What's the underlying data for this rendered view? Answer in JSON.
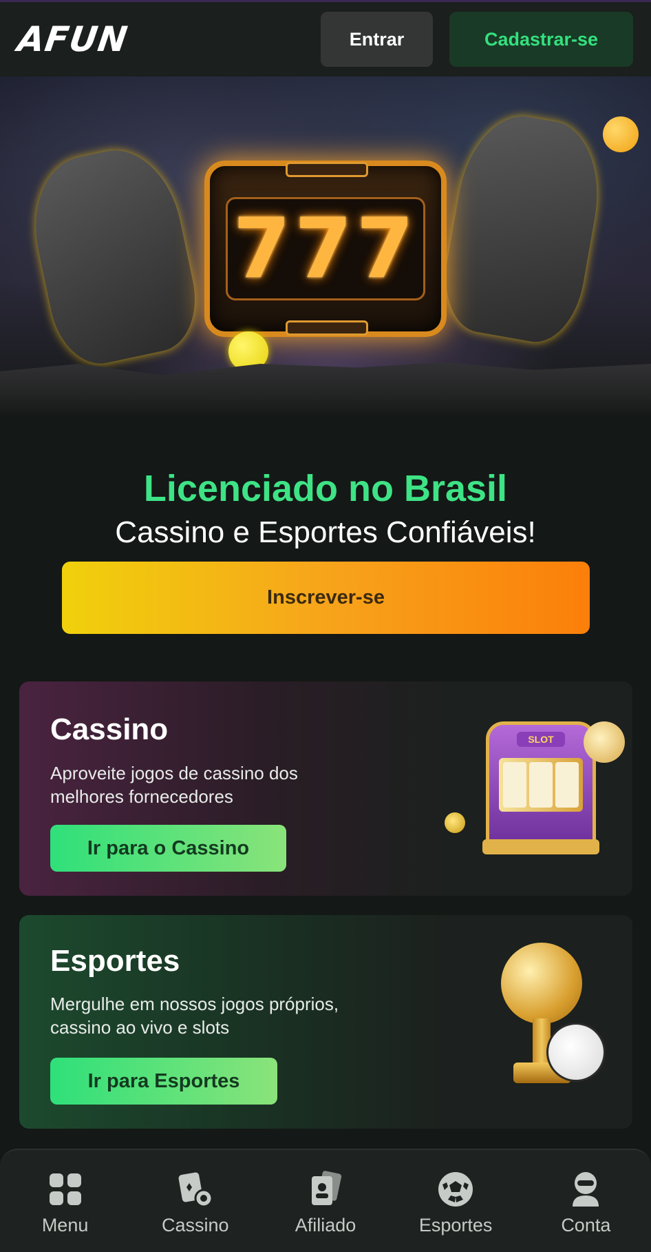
{
  "header": {
    "logo_text": "AFUN",
    "login_label": "Entrar",
    "register_label": "Cadastrar-se"
  },
  "hero": {
    "slot_text": "777"
  },
  "promo": {
    "title": "Licenciado no Brasil",
    "subtitle": "Cassino e Esportes Confiáveis!",
    "signup_label": "Inscrever-se"
  },
  "cards": {
    "casino": {
      "title": "Cassino",
      "description": "Aproveite jogos de cassino dos melhores fornecedores",
      "button_label": "Ir para o Cassino",
      "slot_label": "SLOT"
    },
    "sports": {
      "title": "Esportes",
      "description": "Mergulhe em nossos jogos próprios, cassino ao vivo e slots",
      "button_label": "Ir para Esportes"
    }
  },
  "bottom_nav": {
    "items": [
      {
        "label": "Menu",
        "icon": "grid-icon"
      },
      {
        "label": "Cassino",
        "icon": "cards-chip-icon"
      },
      {
        "label": "Afiliado",
        "icon": "id-card-icon"
      },
      {
        "label": "Esportes",
        "icon": "soccer-ball-icon"
      },
      {
        "label": "Conta",
        "icon": "user-icon"
      }
    ]
  },
  "colors": {
    "background": "#141816",
    "accent_green": "#3ee385",
    "cta_gradient_start": "#f0d10c",
    "cta_gradient_end": "#fb7f0a"
  }
}
